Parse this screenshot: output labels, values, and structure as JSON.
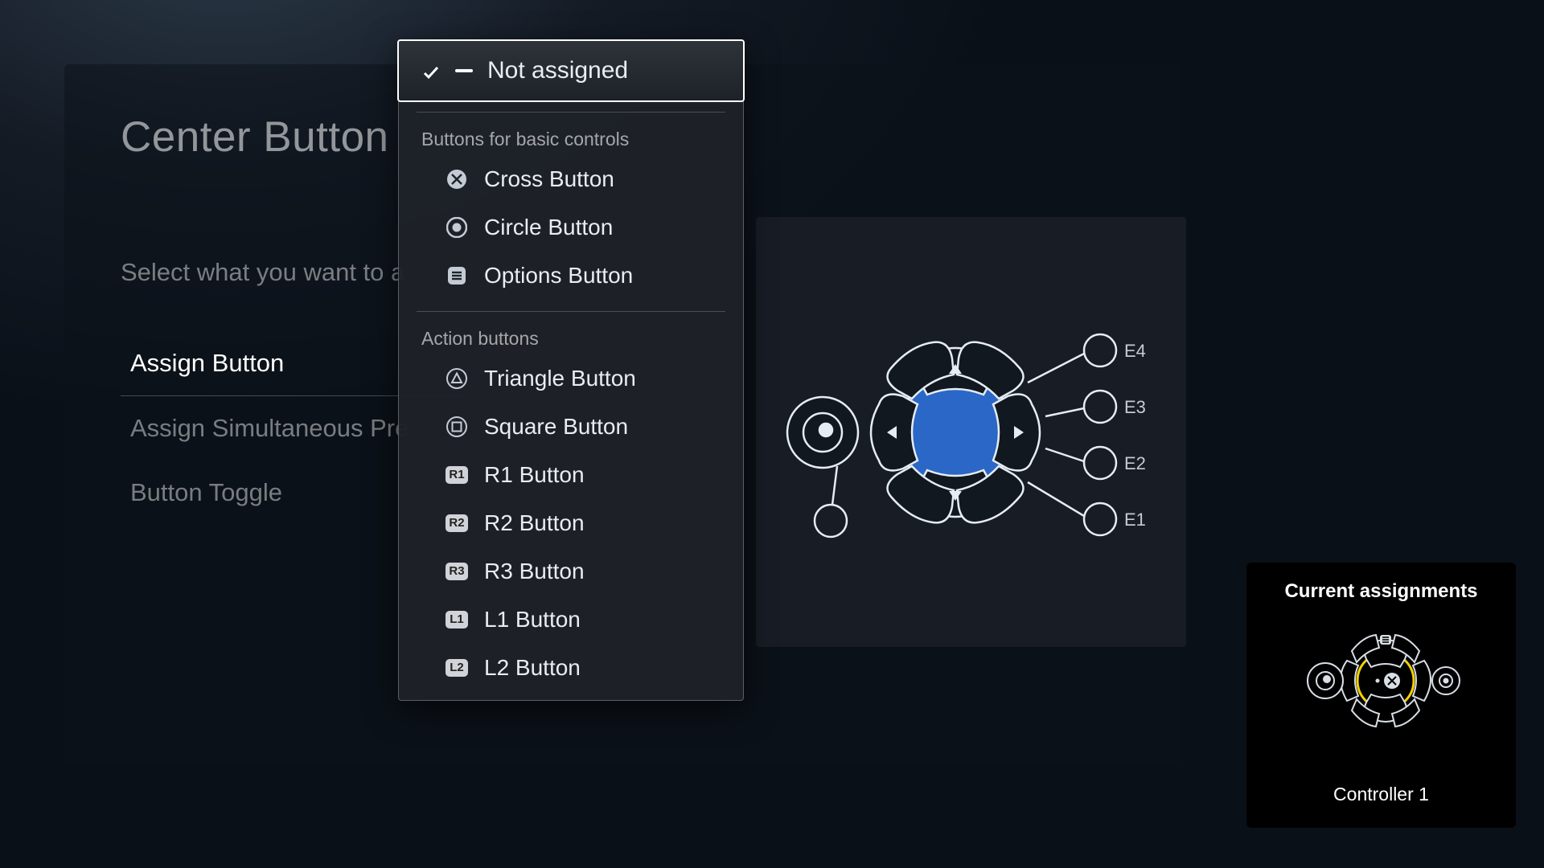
{
  "panel": {
    "title": "Center Button",
    "subtitle": "Select what you want to a"
  },
  "side_menu": {
    "items": [
      {
        "label": "Assign Button",
        "active": true
      },
      {
        "label": "Assign Simultaneous Pre",
        "active": false
      },
      {
        "label": "Button Toggle",
        "active": false
      }
    ]
  },
  "dropdown": {
    "selected": "Not assigned",
    "sections": [
      {
        "label": "Buttons for basic controls",
        "items": [
          {
            "icon": "cross",
            "label": "Cross Button"
          },
          {
            "icon": "circle",
            "label": "Circle Button"
          },
          {
            "icon": "options",
            "label": "Options Button"
          }
        ]
      },
      {
        "label": "Action buttons",
        "items": [
          {
            "icon": "triangle",
            "label": "Triangle Button"
          },
          {
            "icon": "square",
            "label": "Square Button"
          },
          {
            "icon": "badge",
            "badge": "R1",
            "label": "R1 Button"
          },
          {
            "icon": "badge",
            "badge": "R2",
            "label": "R2 Button"
          },
          {
            "icon": "badge",
            "badge": "R3",
            "label": "R3 Button"
          },
          {
            "icon": "badge",
            "badge": "L1",
            "label": "L1 Button"
          },
          {
            "icon": "badge",
            "badge": "L2",
            "label": "L2 Button"
          }
        ]
      }
    ]
  },
  "diagram": {
    "ext_labels": [
      "E4",
      "E3",
      "E2",
      "E1"
    ]
  },
  "current": {
    "title": "Current assignments",
    "controller_label": "Controller 1"
  }
}
